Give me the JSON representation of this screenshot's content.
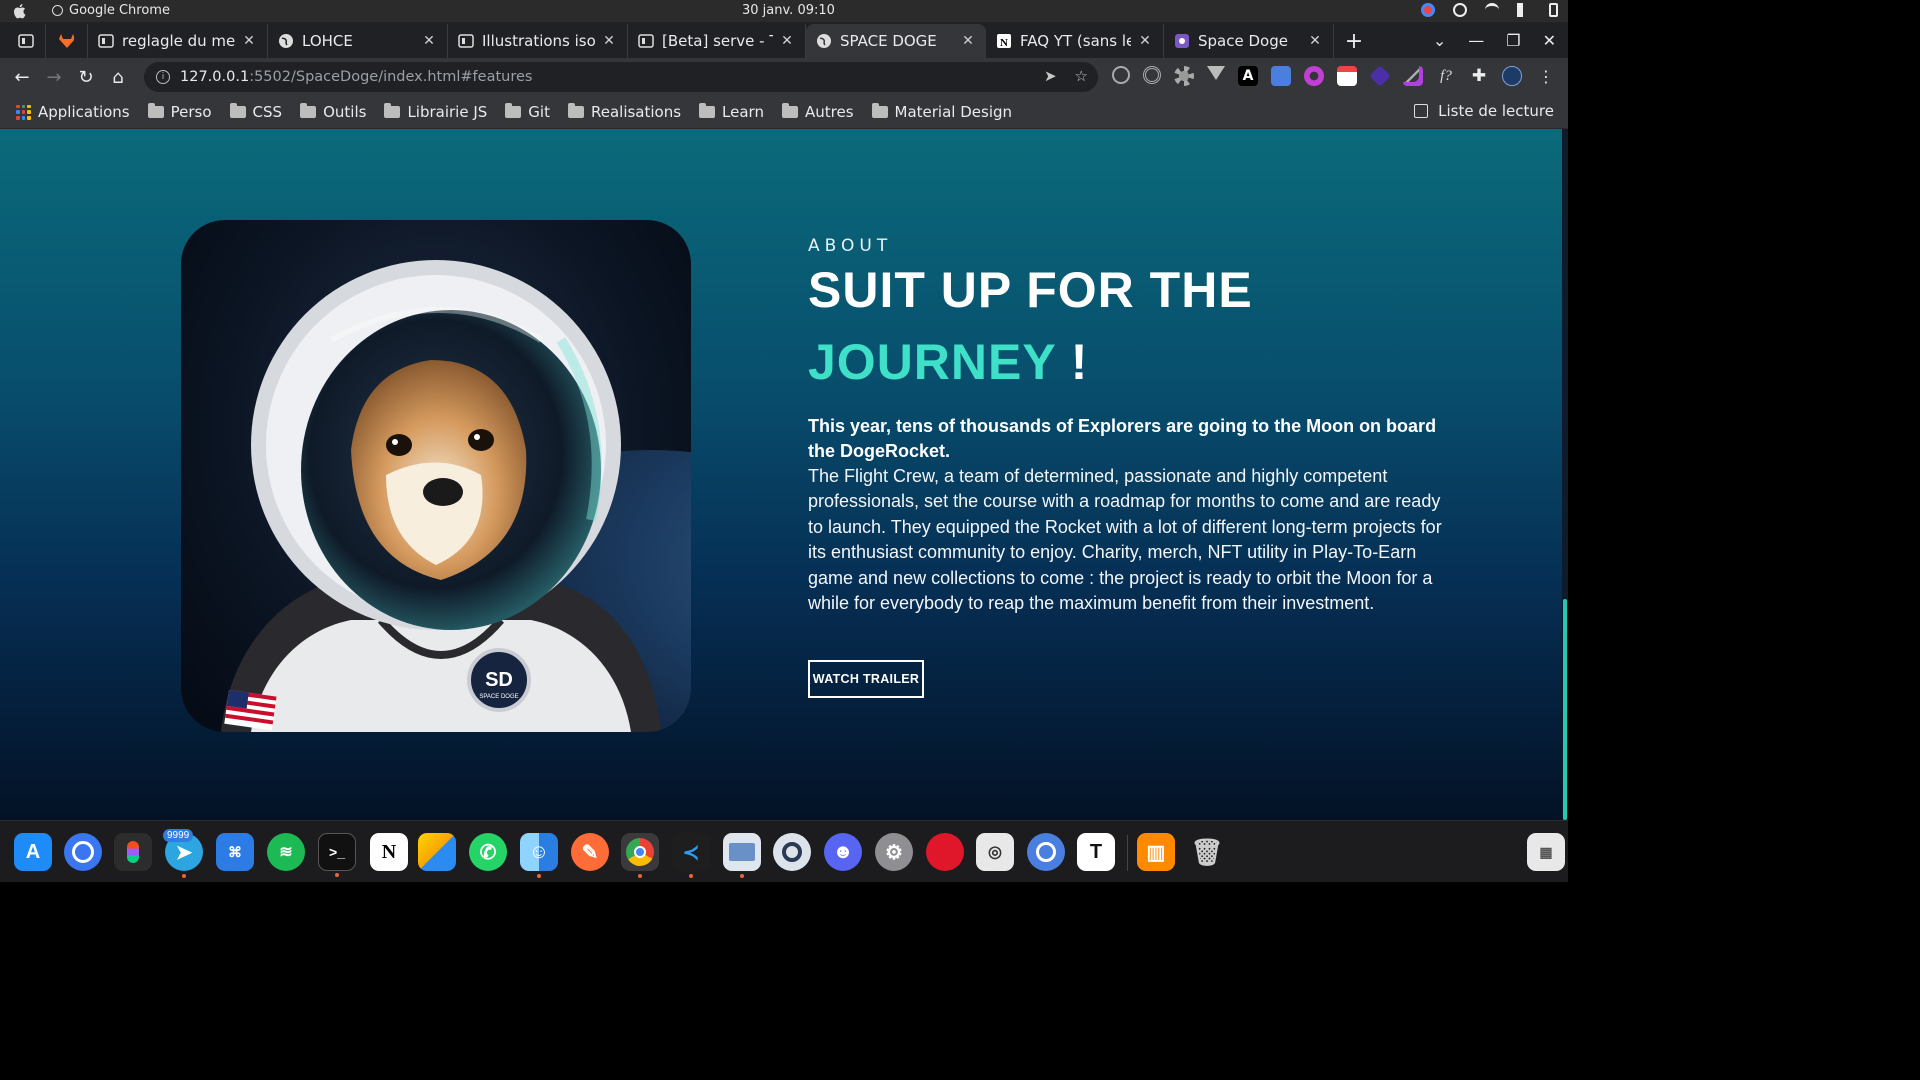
{
  "system_bar": {
    "app_name": "Google Chrome",
    "datetime": "30 janv.  09:10"
  },
  "tabs": [
    {
      "title": "",
      "favicon": "bookmark-icon"
    },
    {
      "title": "",
      "favicon": "gitlab-icon"
    },
    {
      "title": "reglagle du menu",
      "favicon": "image-icon"
    },
    {
      "title": "LOHCE",
      "favicon": "globe-icon"
    },
    {
      "title": "Illustrations isom",
      "favicon": "image-icon"
    },
    {
      "title": "[Beta] serve - Tâ",
      "favicon": "image-icon"
    },
    {
      "title": "SPACE DOGE",
      "favicon": "globe-icon",
      "active": true
    },
    {
      "title": "FAQ YT (sans les",
      "favicon": "notion-icon"
    },
    {
      "title": "Space Doge",
      "favicon": "figma-icon"
    }
  ],
  "toolbar": {
    "url_host": "127.0.0.1",
    "url_path": ":5502/SpaceDoge/index.html#features"
  },
  "bookmarks": {
    "items": [
      "Applications",
      "Perso",
      "CSS",
      "Outils",
      "Librairie JS",
      "Git",
      "Realisations",
      "Learn",
      "Autres",
      "Material Design"
    ],
    "reading_list": "Liste de lecture"
  },
  "page": {
    "eyebrow": "ABOUT",
    "heading_line1": "SUIT UP FOR THE",
    "heading_accent": "JOURNEY",
    "heading_bang": " !",
    "lead": "This year, tens of thousands of Explorers are going to the Moon on board the DogeRocket.",
    "body": "The Flight Crew, a team of determined, passionate and highly competent professionals, set the course with a roadmap for months to come and are ready to launch. They equipped the Rocket with a lot of different long-term projects for its enthusiast community to enjoy. Charity, merch, NFT utility in Play-To-Earn game and new collections to come : the project is ready to orbit the Moon for a while for everybody to reap the maximum benefit from their investment.",
    "cta": "WATCH TRAILER",
    "image_badge": "SD",
    "image_badge_sub": "SPACE DOGE",
    "accent_color": "#3fe0c8"
  },
  "dock": {
    "telegram_badge": "9999",
    "apps": [
      "app-store-icon",
      "signal-icon",
      "figma-icon",
      "telegram-icon",
      "system-monitor-icon",
      "spotify-icon",
      "terminal-icon",
      "notion-icon",
      "sketch-icon",
      "whatsapp-icon",
      "finder-icon",
      "postman-icon",
      "chrome-icon",
      "vscode-icon",
      "preview-icon",
      "quicktime-icon",
      "discord-icon",
      "settings-icon",
      "record-icon",
      "screenshot-icon",
      "chromium-icon",
      "typora-icon",
      "books-icon",
      "trash-icon",
      "launchpad-icon"
    ]
  }
}
